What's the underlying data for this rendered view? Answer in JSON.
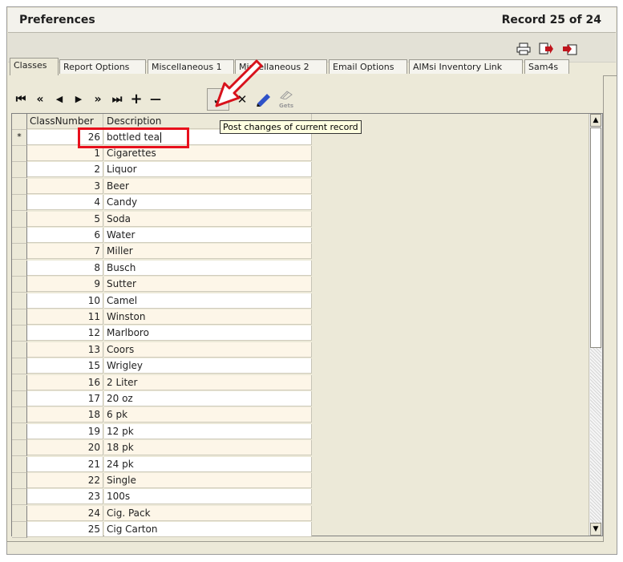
{
  "window": {
    "title": "Preferences",
    "record_label": "Record 25 of 24"
  },
  "top_toolbar": {
    "icons": [
      "printer-icon",
      "export-icon",
      "import-icon"
    ]
  },
  "tabs": [
    {
      "label": "Classes",
      "active": true
    },
    {
      "label": "Report Options",
      "active": false
    },
    {
      "label": "Miscellaneous 1",
      "active": false
    },
    {
      "label": "Miscellaneous 2",
      "active": false
    },
    {
      "label": "Email Options",
      "active": false
    },
    {
      "label": "AIMsi Inventory Link",
      "active": false
    },
    {
      "label": "Sam4s",
      "active": false
    }
  ],
  "nav": {
    "first": "⏮",
    "prior_page": "«",
    "prior": "◀",
    "next": "▶",
    "next_page": "»",
    "last": "⏭",
    "insert": "+",
    "delete": "—",
    "post": "✓",
    "cancel": "✕",
    "refresh_label": "Gets"
  },
  "tooltip": "Post changes of current record",
  "grid": {
    "headers": [
      "ClassNumber",
      "Description"
    ],
    "new_row": {
      "indicator": "*",
      "number": "26",
      "description": "bottled tea"
    },
    "rows": [
      {
        "number": "1",
        "description": "Cigarettes"
      },
      {
        "number": "2",
        "description": "Liquor"
      },
      {
        "number": "3",
        "description": "Beer"
      },
      {
        "number": "4",
        "description": "Candy"
      },
      {
        "number": "5",
        "description": "Soda"
      },
      {
        "number": "6",
        "description": "Water"
      },
      {
        "number": "7",
        "description": "Miller"
      },
      {
        "number": "8",
        "description": "Busch"
      },
      {
        "number": "9",
        "description": "Sutter"
      },
      {
        "number": "10",
        "description": "Camel"
      },
      {
        "number": "11",
        "description": "Winston"
      },
      {
        "number": "12",
        "description": "Marlboro"
      },
      {
        "number": "13",
        "description": "Coors"
      },
      {
        "number": "15",
        "description": "Wrigley"
      },
      {
        "number": "16",
        "description": "2 Liter"
      },
      {
        "number": "17",
        "description": "20 oz"
      },
      {
        "number": "18",
        "description": "6 pk"
      },
      {
        "number": "19",
        "description": "12 pk"
      },
      {
        "number": "20",
        "description": "18 pk"
      },
      {
        "number": "21",
        "description": "24 pk"
      },
      {
        "number": "22",
        "description": "Single"
      },
      {
        "number": "23",
        "description": "100s"
      },
      {
        "number": "24",
        "description": "Cig. Pack"
      },
      {
        "number": "25",
        "description": "Cig Carton"
      }
    ]
  },
  "colors": {
    "highlight": "#e8101c",
    "row_alt": "#fdf6e8",
    "tooltip_bg": "#ffffe1"
  }
}
